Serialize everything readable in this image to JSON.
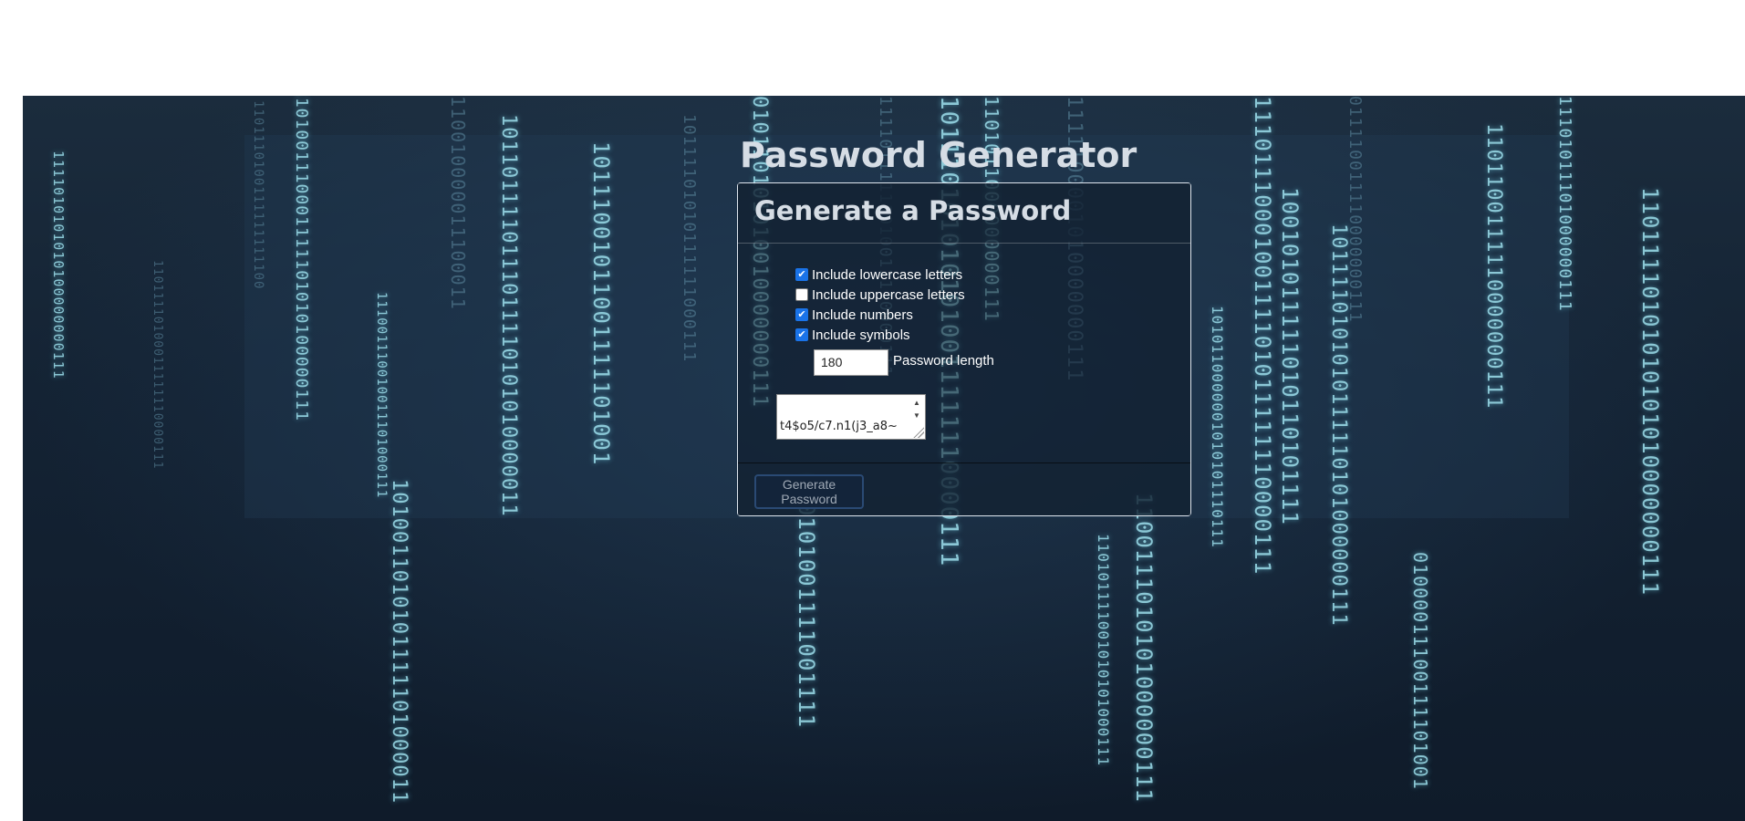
{
  "page": {
    "title": "Password Generator"
  },
  "card": {
    "header": "Generate a Password",
    "options": [
      {
        "label": "Include lowercase letters",
        "checked": true
      },
      {
        "label": "Include uppercase letters",
        "checked": false
      },
      {
        "label": "Include numbers",
        "checked": true
      },
      {
        "label": "Include symbols",
        "checked": true
      }
    ],
    "length_value": "180",
    "length_label": "Password length",
    "password_visible": "t4$o5/c7.n1(j3_a8~",
    "generate_button": "Generate Password"
  },
  "background": {
    "binary_columns": [
      "1111010101010100000000111",
      "11011110100011111110000111",
      "1101110100111111111100",
      "1101001110001111101010100000111",
      "111001110010011101000111",
      "1010011010101111101000011",
      "110010000011100011",
      "1011011110111011110101010000011",
      "10111001011001111101001",
      "10111101010111111000111",
      "010110101010010000000111",
      "010101001111001111",
      "11110111111010011110000111",
      "1011101010101010011111110000111",
      "1101011000000000111",
      "1111100001010000000111",
      "110101111001010101000111",
      "1100111010101000000111",
      "1010110000001010101110111",
      "1110111000100111101011111110000111",
      "100101011111010110101111",
      "1011110101010111110101000000111",
      "011110011110000000111",
      "01000011100111101001",
      "1101100111110000000111",
      "11101011101000000111",
      "11011110101010101010000000111"
    ]
  },
  "colors": {
    "accent_checkbox": "#1a73e8",
    "text_light": "#d6dde5",
    "binary_glow": "#9fe3f0"
  }
}
